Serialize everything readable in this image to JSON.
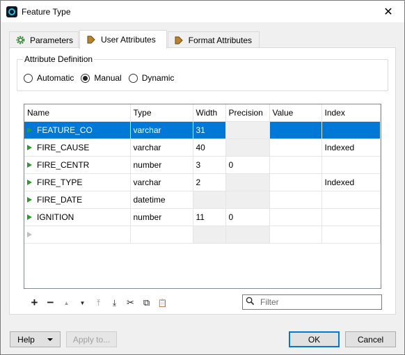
{
  "window": {
    "title": "Feature Type",
    "close_label": "✕"
  },
  "tabs": [
    {
      "label": "Parameters",
      "icon": "gear-icon"
    },
    {
      "label": "User Attributes",
      "icon": "attribute-arrow-icon",
      "active": true
    },
    {
      "label": "Format Attributes",
      "icon": "attribute-arrow-icon"
    }
  ],
  "attribute_definition": {
    "legend": "Attribute Definition",
    "options": [
      {
        "label": "Automatic",
        "selected": false
      },
      {
        "label": "Manual",
        "selected": true
      },
      {
        "label": "Dynamic",
        "selected": false
      }
    ]
  },
  "grid": {
    "columns": [
      "Name",
      "Type",
      "Width",
      "Precision",
      "Value",
      "Index"
    ],
    "rows": [
      {
        "name": "FEATURE_CO",
        "type": "varchar",
        "width": "31",
        "precision": "",
        "value": "",
        "index": "",
        "selected": true
      },
      {
        "name": "FIRE_CAUSE",
        "type": "varchar",
        "width": "40",
        "precision": "",
        "value": "",
        "index": "Indexed"
      },
      {
        "name": "FIRE_CENTR",
        "type": "number",
        "width": "3",
        "precision": "0",
        "value": "",
        "index": ""
      },
      {
        "name": "FIRE_TYPE",
        "type": "varchar",
        "width": "2",
        "precision": "",
        "value": "",
        "index": "Indexed"
      },
      {
        "name": "FIRE_DATE",
        "type": "datetime",
        "width": "",
        "precision": "",
        "value": "",
        "index": ""
      },
      {
        "name": "IGNITION",
        "type": "number",
        "width": "11",
        "precision": "0",
        "value": "",
        "index": ""
      },
      {
        "name": "",
        "type": "",
        "width": "",
        "precision": "",
        "value": "",
        "index": ""
      }
    ]
  },
  "toolbar": {
    "add": "+",
    "remove": "−",
    "move_up": "▲",
    "move_down": "▼",
    "move_top": "⤒",
    "move_bottom": "⤓",
    "cut": "✂",
    "copy": "⧉",
    "paste": "📋"
  },
  "filter": {
    "placeholder": "Filter",
    "value": ""
  },
  "buttons": {
    "help": "Help",
    "apply": "Apply to...",
    "ok": "OK",
    "cancel": "Cancel"
  },
  "colors": {
    "selection": "#0078d7",
    "arrow_green": "#2a9b2a"
  }
}
